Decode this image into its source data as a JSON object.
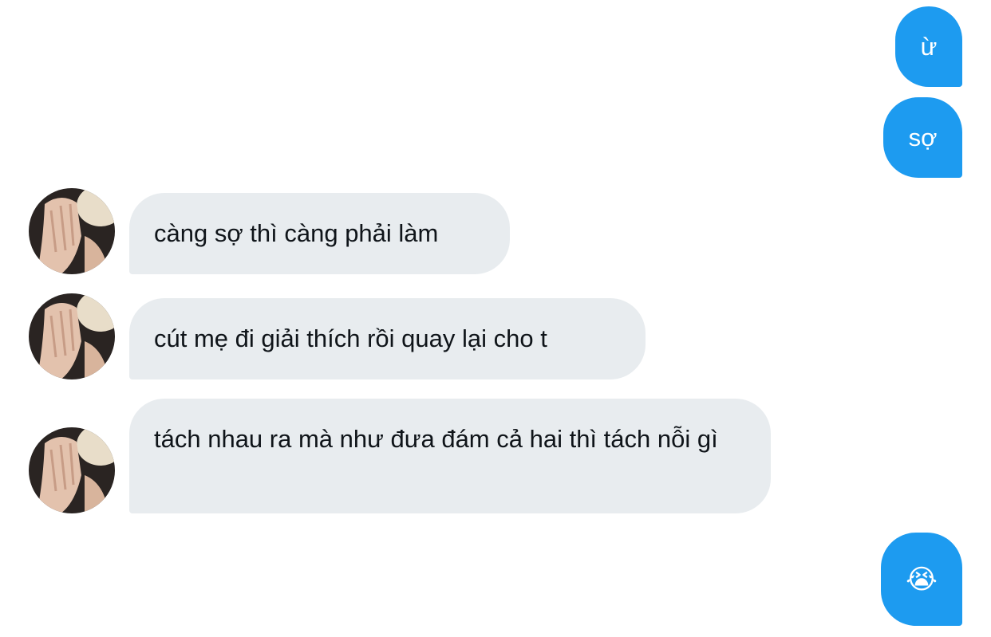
{
  "messages": {
    "out_1": {
      "text": "ừ"
    },
    "out_2": {
      "text": "sợ"
    },
    "in_1": {
      "text": "càng sợ thì càng phải làm"
    },
    "in_2": {
      "text": "cút mẹ đi giải thích rồi quay lại cho t"
    },
    "in_3": {
      "text": "tách nhau ra mà như đưa đám cả hai thì tách nỗi gì"
    },
    "out_3": {
      "text": "😭"
    }
  },
  "colors": {
    "outgoing_bubble": "#1d9bf0",
    "incoming_bubble": "#e8ecef",
    "incoming_text": "#0f1419",
    "background": "#ffffff"
  },
  "avatar": {
    "icon": "user-avatar-photo"
  }
}
